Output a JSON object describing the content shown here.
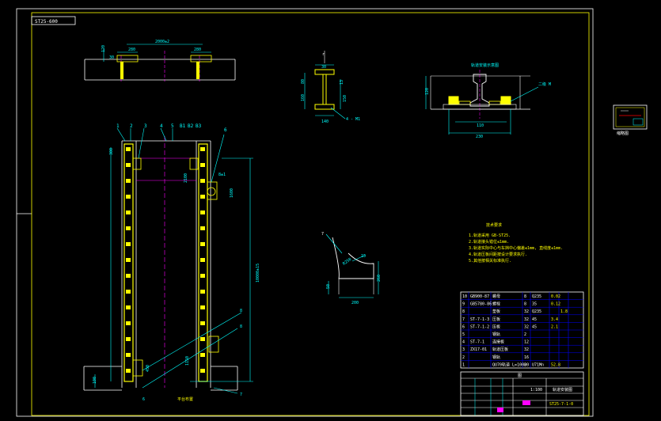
{
  "title_tag": "ST25-600",
  "colors": {
    "background": "#000000",
    "border": "#ffffff",
    "rail": "#ffff00",
    "dimension": "#00ffff",
    "centerline": "#ff00ff",
    "note": "#ffff00",
    "hatch": "#ff9900",
    "table_blue": "#0000ff"
  },
  "top_view": {
    "dim_overall": "2000±2",
    "dim_left_pad": "280",
    "dim_right_pad": "280",
    "dim_height": "120",
    "dim_small": "30"
  },
  "front_view": {
    "balloons": [
      "1",
      "2",
      "3",
      "4",
      "5",
      "B1",
      "B2",
      "B3"
    ],
    "right_balloon": "6",
    "dim_top_pad": "300",
    "dim_total": "10000±15",
    "dim_length_small": "2100",
    "dim_spacing": "8±1",
    "dim_bottom": "100",
    "dim_bottom_side": "1150",
    "dim_left_bottom": "450",
    "dim_width_bottom": "1600",
    "bottom_labels": [
      "6",
      "8",
      "7",
      "8"
    ],
    "bottom_text": "平台布置"
  },
  "section_view": {
    "label_top": "r",
    "dim_top": "30",
    "dim_left1": "80",
    "dim_left2": "160",
    "dim_right1": "13",
    "dim_right2": "150",
    "dim_bottom": "140",
    "callout": "4 - M1"
  },
  "rail_view": {
    "title": "轨道安装示意图",
    "dim_height": "120",
    "dim_inner": "110",
    "dim_outer": "230",
    "callout": "二级 M"
  },
  "bracket_view": {
    "label": "7",
    "dim_radius": "R250",
    "dim_top": "15",
    "dim_left": "50",
    "dim_right": "260",
    "dim_bottom": "200"
  },
  "notes": {
    "title": "技术要求",
    "lines": [
      "1.轨道采用 GB-ST25.",
      "2.轨道接头错位≤1mm.",
      "3.轨道实际中心与车挡中心偏差≤1mm, 直线度≤1mm.",
      "4.轨道压板间距按设计要求执行.",
      "5.其他按相关标准执行."
    ]
  },
  "bom": {
    "rows": [
      [
        "10",
        "GB900-87",
        "螺母",
        "8",
        "Q235",
        "0.02",
        ""
      ],
      [
        "9",
        "GB5780-86",
        "螺栓",
        "8",
        "35",
        "0.12",
        ""
      ],
      [
        "8",
        "",
        "垫板",
        "32",
        "Q235",
        "",
        "1.8"
      ],
      [
        "7",
        "ST-7-1-3",
        "压板",
        "32",
        "45",
        "3.4",
        ""
      ],
      [
        "6",
        "ST-7-1-2",
        "压板",
        "32",
        "45",
        "2.1",
        ""
      ],
      [
        "5",
        "",
        "钢轨",
        "2",
        "",
        "",
        ""
      ],
      [
        "4",
        "ST-7-1",
        "连接板",
        "12",
        "",
        "",
        ""
      ],
      [
        "3",
        "ZX17-01",
        "轨道压板",
        "32",
        "",
        "",
        ""
      ],
      [
        "2",
        "",
        "钢轨",
        "16",
        "",
        "",
        ""
      ],
      [
        "1",
        "",
        "QU70轨道 L=10000",
        "2",
        "U71Mn",
        "52.8",
        ""
      ]
    ],
    "title_block": {
      "drawing_name": "轨道安装图",
      "drawing_number": "ST25-7-1-0",
      "company": "图",
      "scale": "1:100"
    }
  },
  "thumbnail_label": "缩略图"
}
